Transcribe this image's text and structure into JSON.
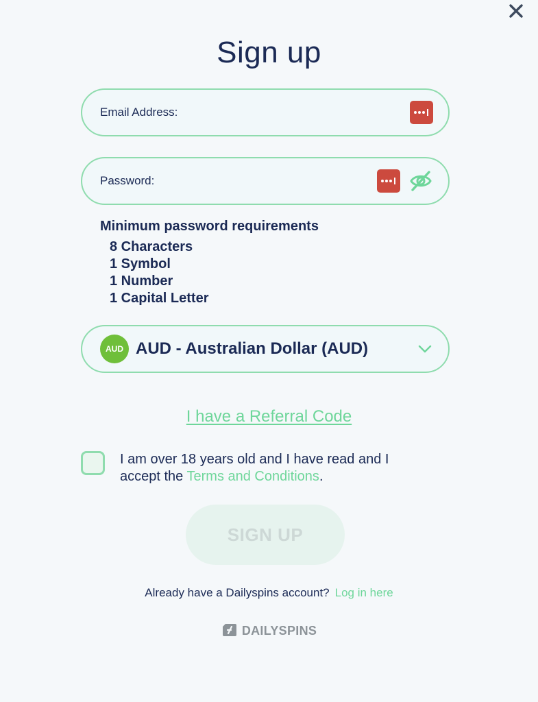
{
  "dialog": {
    "close_icon": "close-icon",
    "title": "Sign up"
  },
  "form": {
    "email": {
      "placeholder": "Email Address:",
      "value": "",
      "autofill_icon": "password-manager-icon"
    },
    "password": {
      "placeholder": "Password:",
      "value": "",
      "autofill_icon": "password-manager-icon",
      "visibility_icon": "eye-slash-icon"
    },
    "requirements": {
      "title": "Minimum password requirements",
      "items": [
        "8 Characters",
        "1 Symbol",
        "1 Number",
        "1 Capital Letter"
      ]
    },
    "currency": {
      "badge": "AUD",
      "label": "AUD - Australian Dollar (AUD)",
      "icon": "chevron-down-icon"
    },
    "referral_link": "I have a Referral Code",
    "consent": {
      "checked": false,
      "text": "I am over 18 years old and I have read and I accept the",
      "link": "Terms and Conditions",
      "suffix": "."
    },
    "submit_label": "SIGN UP"
  },
  "footer": {
    "prompt": "Already have a Dailyspins account?",
    "login_link": "Log in here",
    "brand": "DAILYSPINS"
  },
  "colors": {
    "accent": "#6ed69a",
    "border": "#8fdcae",
    "text": "#1b2a55",
    "autofill": "#cc4a3e",
    "currency_badge": "#6fbf3a",
    "disabled_button_bg": "#e6f3ee",
    "disabled_button_text": "#cdd8d6"
  }
}
